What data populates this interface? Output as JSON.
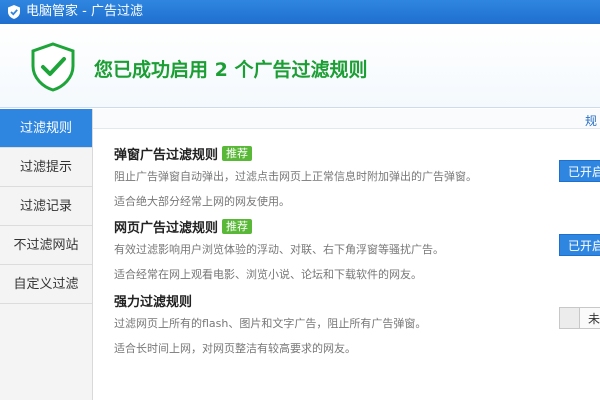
{
  "window": {
    "title": "电脑管家 - 广告过滤",
    "icon": "qq-pc-manager-shield-icon",
    "brand_color": "#2f86e0"
  },
  "header": {
    "headline": "您已成功启用 2 个广告过滤规则",
    "headline_color": "#1b9e33",
    "icon": "shield-check-icon"
  },
  "sidebar": {
    "items": [
      {
        "label": "过滤规则",
        "active": true
      },
      {
        "label": "过滤提示",
        "active": false
      },
      {
        "label": "过滤记录",
        "active": false
      },
      {
        "label": "不过滤网站",
        "active": false
      },
      {
        "label": "自定义过滤",
        "active": false
      }
    ]
  },
  "main": {
    "top_link": "规",
    "rules": [
      {
        "title": "弹窗广告过滤规则",
        "badge": "推荐",
        "description": "阻止广告弹窗自动弹出，过滤点击网页上正常信息时附加弹出的广告弹窗。",
        "note": "适合绝大部分经常上网的网友使用。",
        "status": "已开启"
      },
      {
        "title": "网页广告过滤规则",
        "badge": "推荐",
        "description": "有效过滤影响用户浏览体验的浮动、对联、右下角浮窗等骚扰广告。",
        "note": "适合经常在网上观看电影、浏览小说、论坛和下载软件的网友。",
        "status": "已开启"
      },
      {
        "title": "强力过滤规则",
        "description": "过滤网页上所有的flash、图片和文字广告，阻止所有广告弹窗。",
        "note": "适合长时间上网，对网页整洁有较高要求的网友。",
        "status": "未"
      }
    ]
  }
}
